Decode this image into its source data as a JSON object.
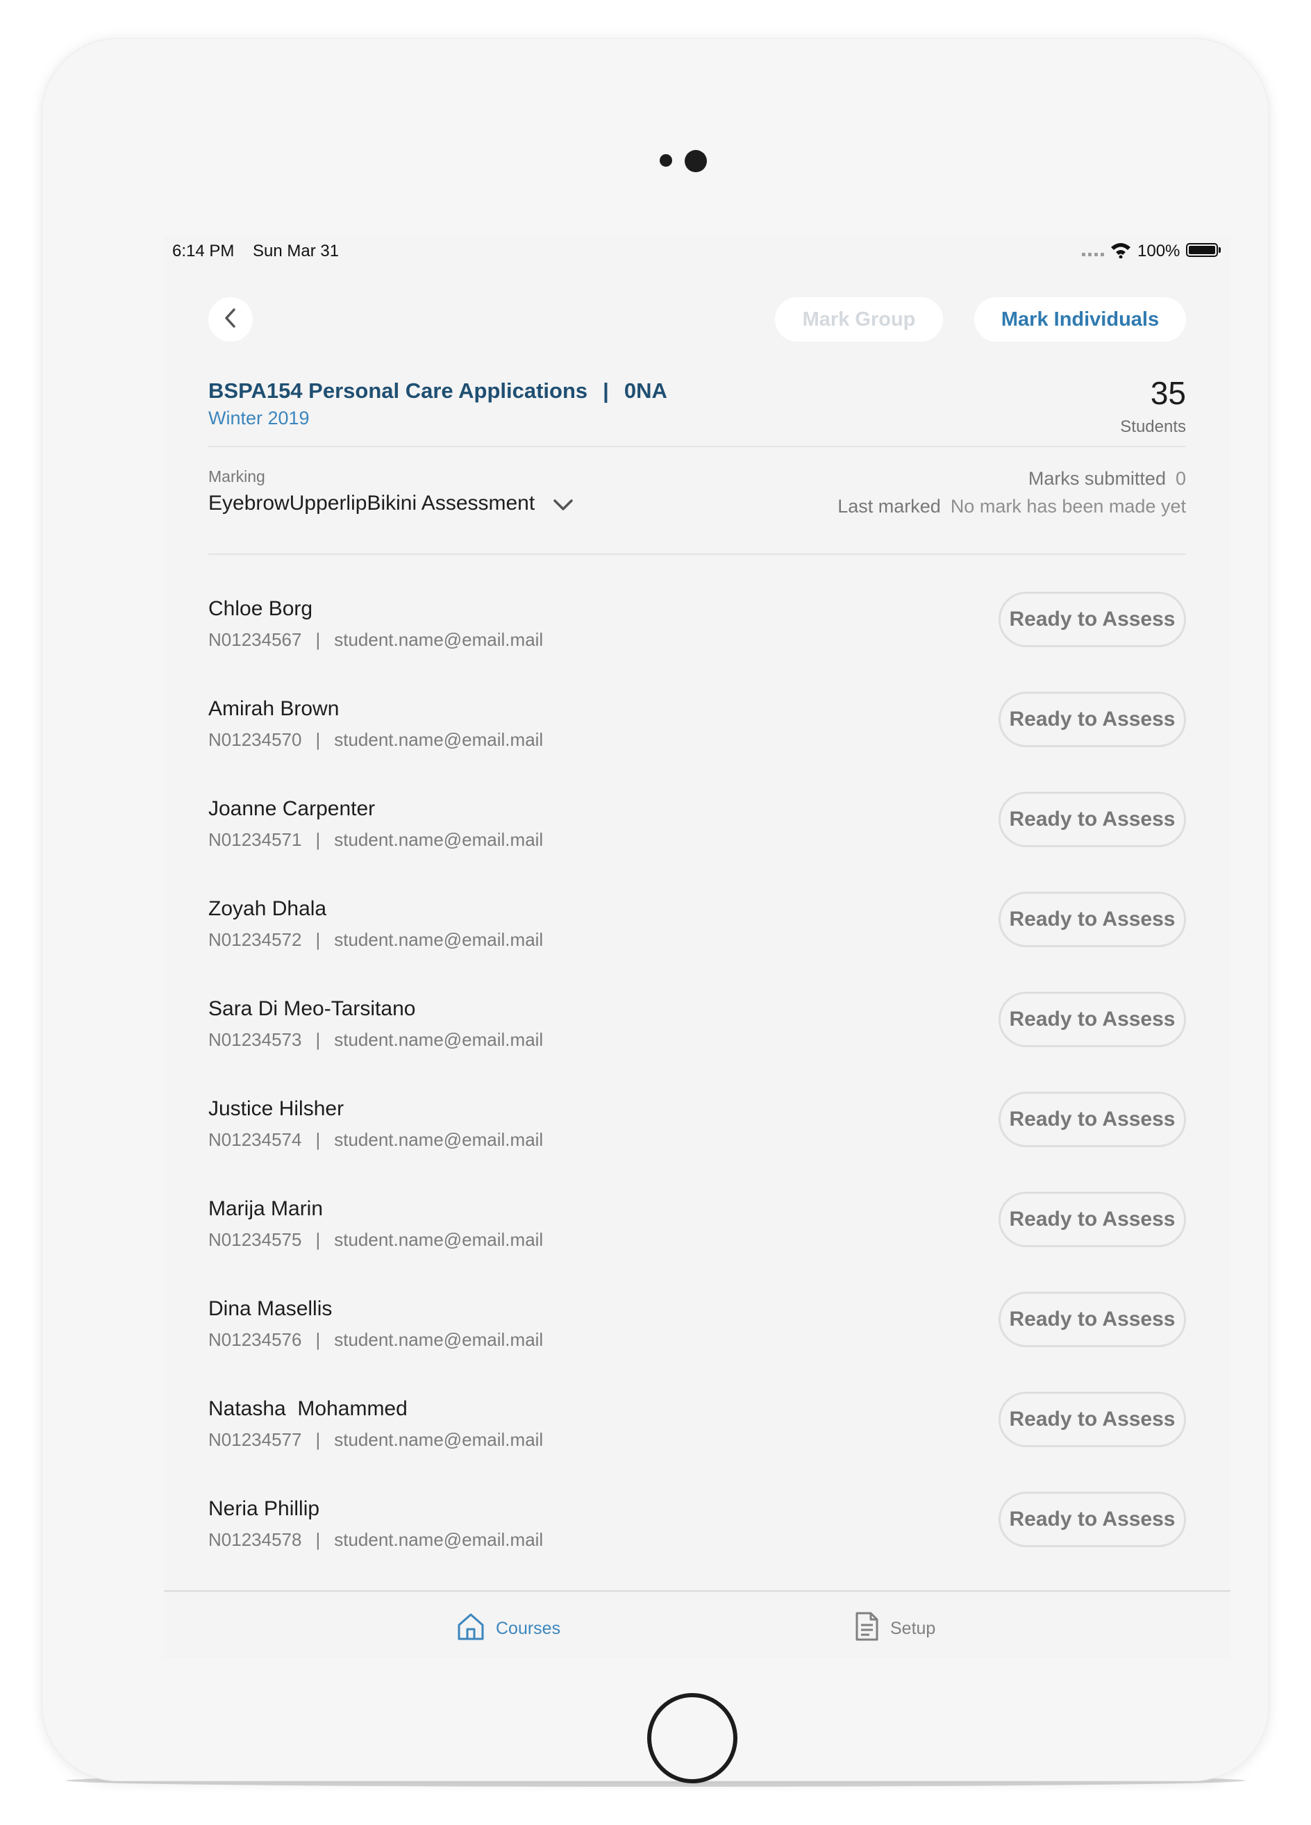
{
  "status_bar": {
    "time": "6:14 PM",
    "date": "Sun Mar 31",
    "battery": "100%"
  },
  "top_bar": {
    "mark_group_label": "Mark Group",
    "mark_individuals_label": "Mark Individuals"
  },
  "course": {
    "title": "BSPA154 Personal Care Applications",
    "separator": "|",
    "section": "0NA",
    "term": "Winter 2019",
    "student_count": "35",
    "student_count_label": "Students"
  },
  "marking": {
    "label": "Marking",
    "assessment": "EyebrowUpperlipBikini Assessment",
    "marks_submitted_label": "Marks submitted",
    "marks_submitted_value": "0",
    "last_marked_label": "Last marked",
    "last_marked_value": "No mark has been made yet"
  },
  "students": [
    {
      "name": "Chloe Borg",
      "id": "N01234567",
      "email": "student.name@email.mail",
      "action": "Ready to Assess"
    },
    {
      "name": "Amirah Brown",
      "id": "N01234570",
      "email": "student.name@email.mail",
      "action": "Ready to Assess"
    },
    {
      "name": "Joanne Carpenter",
      "id": "N01234571",
      "email": "student.name@email.mail",
      "action": "Ready to Assess"
    },
    {
      "name": "Zoyah Dhala",
      "id": "N01234572",
      "email": "student.name@email.mail",
      "action": "Ready to Assess"
    },
    {
      "name": "Sara Di Meo-Tarsitano",
      "id": "N01234573",
      "email": "student.name@email.mail",
      "action": "Ready to Assess"
    },
    {
      "name": "Justice Hilsher",
      "id": "N01234574",
      "email": "student.name@email.mail",
      "action": "Ready to Assess"
    },
    {
      "name": "Marija Marin",
      "id": "N01234575",
      "email": "student.name@email.mail",
      "action": "Ready to Assess"
    },
    {
      "name": "Dina Masellis",
      "id": "N01234576",
      "email": "student.name@email.mail",
      "action": "Ready to Assess"
    },
    {
      "name": "Natasha  Mohammed",
      "id": "N01234577",
      "email": "student.name@email.mail",
      "action": "Ready to Assess"
    },
    {
      "name": "Neria Phillip",
      "id": "N01234578",
      "email": "student.name@email.mail",
      "action": "Ready to Assess"
    }
  ],
  "tab_bar": {
    "tabs": [
      {
        "label": "Courses",
        "icon": "home-icon",
        "active": true
      },
      {
        "label": "Setup",
        "icon": "document-icon",
        "active": false
      }
    ]
  },
  "colors": {
    "accent": "#2f7ab0",
    "title": "#1f4f72",
    "term": "#3c86bd",
    "disabled": "#d4d9de"
  }
}
